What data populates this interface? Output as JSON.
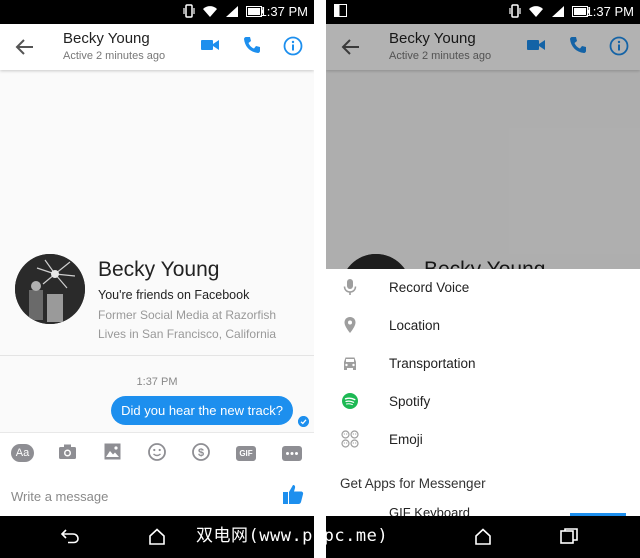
{
  "status_bar": {
    "time": "1:37 PM"
  },
  "header": {
    "contact_name": "Becky Young",
    "active_status": "Active 2 minutes ago"
  },
  "profile": {
    "name": "Becky Young",
    "friends_line": "You're friends on Facebook",
    "work": "Former Social Media at Razorfish",
    "location": "Lives in San Francisco, California"
  },
  "conversation": {
    "timestamp": "1:37 PM",
    "messages": [
      {
        "text": "Did you hear the new track?",
        "from": "me"
      }
    ]
  },
  "toolbar": {
    "text_button": "Aa",
    "gif_button": "GIF"
  },
  "composer": {
    "placeholder": "Write a message"
  },
  "more_sheet": {
    "items": [
      {
        "label": "Record Voice",
        "icon": "microphone-icon"
      },
      {
        "label": "Location",
        "icon": "location-pin-icon"
      },
      {
        "label": "Transportation",
        "icon": "car-icon"
      },
      {
        "label": "Spotify",
        "icon": "spotify-icon"
      },
      {
        "label": "Emoji",
        "icon": "emoji-grid-icon"
      }
    ],
    "heading": "Get Apps for Messenger",
    "partial_item": "GIF Keyboard"
  },
  "colors": {
    "accent": "#1d8fee",
    "spotify": "#1db954",
    "icon_gray": "#8e8e93"
  },
  "watermark": "双电网(www.pcpc.me)"
}
